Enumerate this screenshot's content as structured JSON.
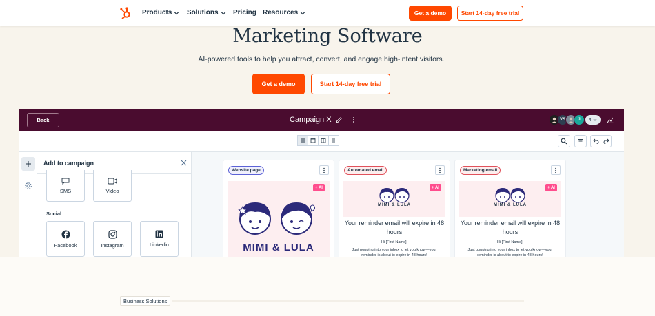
{
  "nav": {
    "items": [
      {
        "label": "Products",
        "has_dropdown": true
      },
      {
        "label": "Solutions",
        "has_dropdown": true
      },
      {
        "label": "Pricing",
        "has_dropdown": false
      },
      {
        "label": "Resources",
        "has_dropdown": true
      }
    ],
    "demo_label": "Get a demo",
    "trial_label": "Start 14-day free trial"
  },
  "hero": {
    "title": "Marketing Software",
    "subtitle": "AI-powered tools to help you attract, convert, and engage high-intent visitors.",
    "demo_label": "Get a demo",
    "trial_label": "Start 14-day free trial"
  },
  "app": {
    "back_label": "Back",
    "campaign_title": "Campaign X",
    "avatar_initials": [
      "",
      "VS",
      "",
      "J"
    ],
    "avatar_count": "4",
    "panel": {
      "title": "Add to campaign",
      "top_tiles": [
        {
          "label": "SMS",
          "icon": "sms-icon"
        },
        {
          "label": "Video",
          "icon": "video-icon"
        }
      ],
      "section_social": "Social",
      "social_tiles": [
        {
          "label": "Facebook",
          "icon": "facebook-icon"
        },
        {
          "label": "Instagram",
          "icon": "instagram-icon"
        },
        {
          "label": "Linkedin",
          "icon": "linkedin-icon"
        }
      ]
    },
    "cards": [
      {
        "tag": "Website page",
        "ai": "+ AI",
        "brand": "MIMI & LULA"
      },
      {
        "tag": "Automated email",
        "ai": "+ AI",
        "brand": "MIMI & LULA",
        "heading": "Your reminder email will expire in 48 hours",
        "greeting": "Hi [First Name],",
        "body": "Just popping into your inbox to let you know—your reminder is about to expire in 48 hours!"
      },
      {
        "tag": "Marketing email",
        "ai": "+ AI",
        "brand": "MIMI & LULA",
        "heading": "Your reminder email will expire in 48 hours",
        "greeting": "Hi [First Name],",
        "body": "Just popping into your inbox to let you know—your reminder is about to expire in 48 hours!"
      }
    ]
  },
  "footer": {
    "badge": "Business Solutions"
  },
  "colors": {
    "brand_orange": "#ff4800",
    "app_header": "#4a0c2f",
    "page_bg": "#f8f4ec",
    "text": "#213343"
  }
}
